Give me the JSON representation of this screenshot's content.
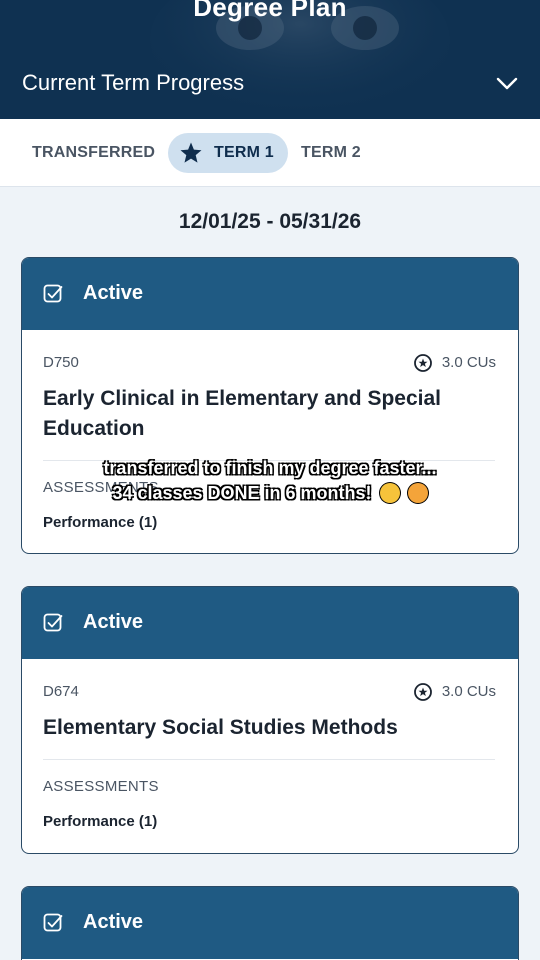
{
  "header": {
    "title": "Degree Plan",
    "subtitle": "Current Term Progress",
    "chevron_icon": "chevron-down-icon"
  },
  "tabs": [
    {
      "label": "TRANSFERRED",
      "active": false
    },
    {
      "label": "TERM 1",
      "active": true,
      "icon": "star-icon"
    },
    {
      "label": "TERM 2",
      "active": false
    }
  ],
  "date_range": "12/01/25 - 05/31/26",
  "cards": [
    {
      "status": "Active",
      "status_icon": "check-square-icon",
      "code": "D750",
      "cus": "3.0 CUs",
      "title": "Early Clinical in Elementary and Special Education",
      "assessments_label": "ASSESSMENTS",
      "assessments_value": "Performance (1)"
    },
    {
      "status": "Active",
      "status_icon": "check-square-icon",
      "code": "D674",
      "cus": "3.0 CUs",
      "title": "Elementary Social Studies Methods",
      "assessments_label": "ASSESSMENTS",
      "assessments_value": "Performance (1)"
    },
    {
      "status": "Active",
      "status_icon": "check-square-icon"
    }
  ],
  "overlay": {
    "line1": "transferred to finish my degree faster...",
    "line2": "34 classes DONE in 6 months!",
    "emojis": [
      "star-struck-emoji",
      "exploding-head-emoji"
    ]
  },
  "colors": {
    "header_bg": "#0f3151",
    "card_header": "#1f5a83",
    "active_tab_bg": "#cfe0ef",
    "page_bg": "#eef3f8"
  }
}
